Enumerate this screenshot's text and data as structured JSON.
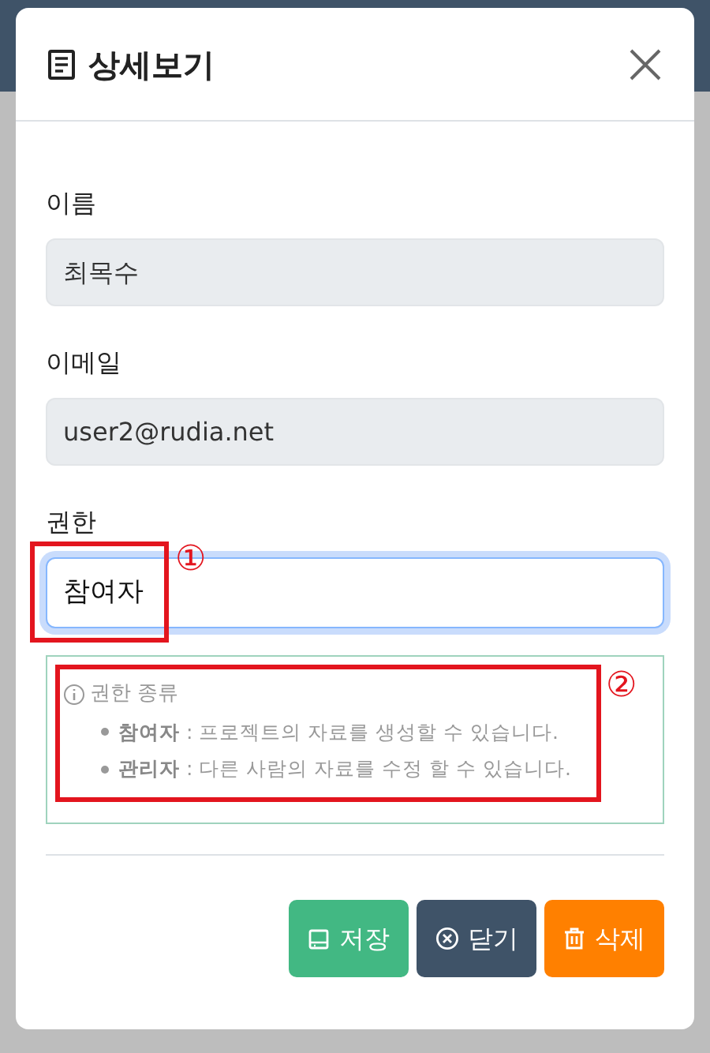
{
  "dialog": {
    "title": "상세보기"
  },
  "fields": [
    {
      "label": "이름",
      "value": "최목수",
      "disabled": true
    },
    {
      "label": "이메일",
      "value": "user2@rudia.net",
      "disabled": true
    },
    {
      "label": "권한",
      "value": "참여자",
      "disabled": false
    }
  ],
  "info": {
    "title": "권한 종류",
    "items": [
      {
        "term": "참여자",
        "text": " : 프로젝트의 자료를 생성할 수 있습니다."
      },
      {
        "term": "관리자",
        "text": " : 다른 사람의 자료를 수정 할 수 있습니다."
      }
    ]
  },
  "buttons": [
    {
      "label": "저장",
      "kind": "save"
    },
    {
      "label": "닫기",
      "kind": "close"
    },
    {
      "label": "삭제",
      "kind": "delete"
    }
  ],
  "annotations": [
    "①",
    "②"
  ]
}
